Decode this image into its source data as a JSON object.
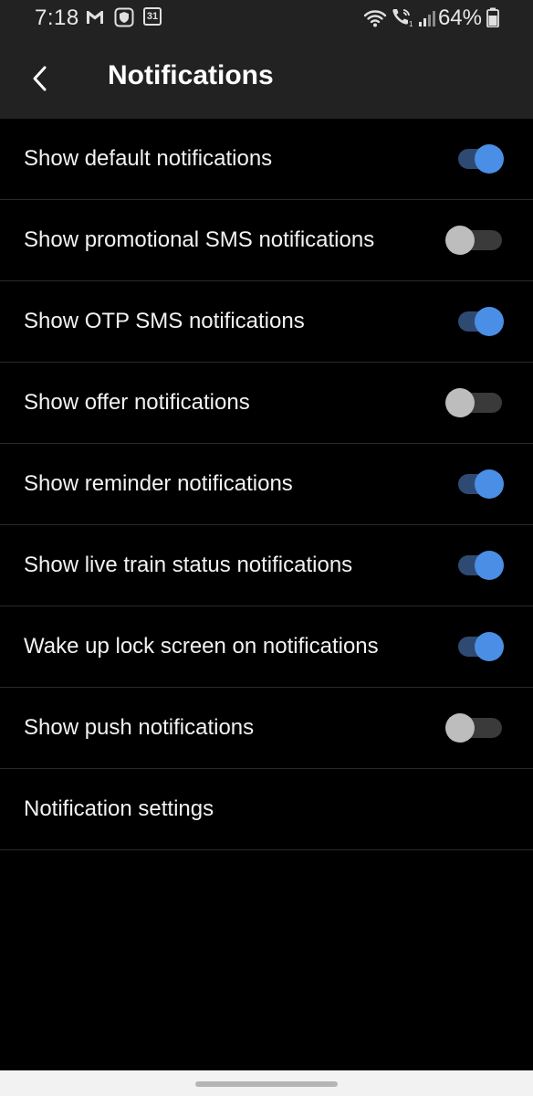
{
  "status_bar": {
    "time": "7:18",
    "battery_percent": "64%",
    "left_icons": [
      "gmail-icon",
      "shield-app-icon",
      "calendar-icon"
    ],
    "calendar_day": "31",
    "right_icons": [
      "wifi-icon",
      "wifi-calling-icon",
      "signal-icon",
      "battery-icon"
    ]
  },
  "app_bar": {
    "title": "Notifications",
    "back_icon": "chevron-left-icon"
  },
  "settings": [
    {
      "label": "Show default notifications",
      "toggle": true
    },
    {
      "label": "Show promotional SMS notifications",
      "toggle": false
    },
    {
      "label": "Show OTP SMS notifications",
      "toggle": true
    },
    {
      "label": "Show offer notifications",
      "toggle": false
    },
    {
      "label": "Show reminder notifications",
      "toggle": true
    },
    {
      "label": "Show live train status notifications",
      "toggle": true
    },
    {
      "label": "Wake up lock screen on notifications",
      "toggle": true
    },
    {
      "label": "Show push notifications",
      "toggle": false
    },
    {
      "label": "Notification settings",
      "toggle": null
    }
  ],
  "colors": {
    "background": "#000000",
    "bar_background": "#222222",
    "toggle_on_thumb": "#4a8ee6",
    "toggle_on_track": "#2f4a72",
    "toggle_off_thumb": "#bdbdbd",
    "toggle_off_track": "#3a3a3a",
    "divider": "#2a2a2a",
    "nav_bar": "#f2f2f2"
  }
}
